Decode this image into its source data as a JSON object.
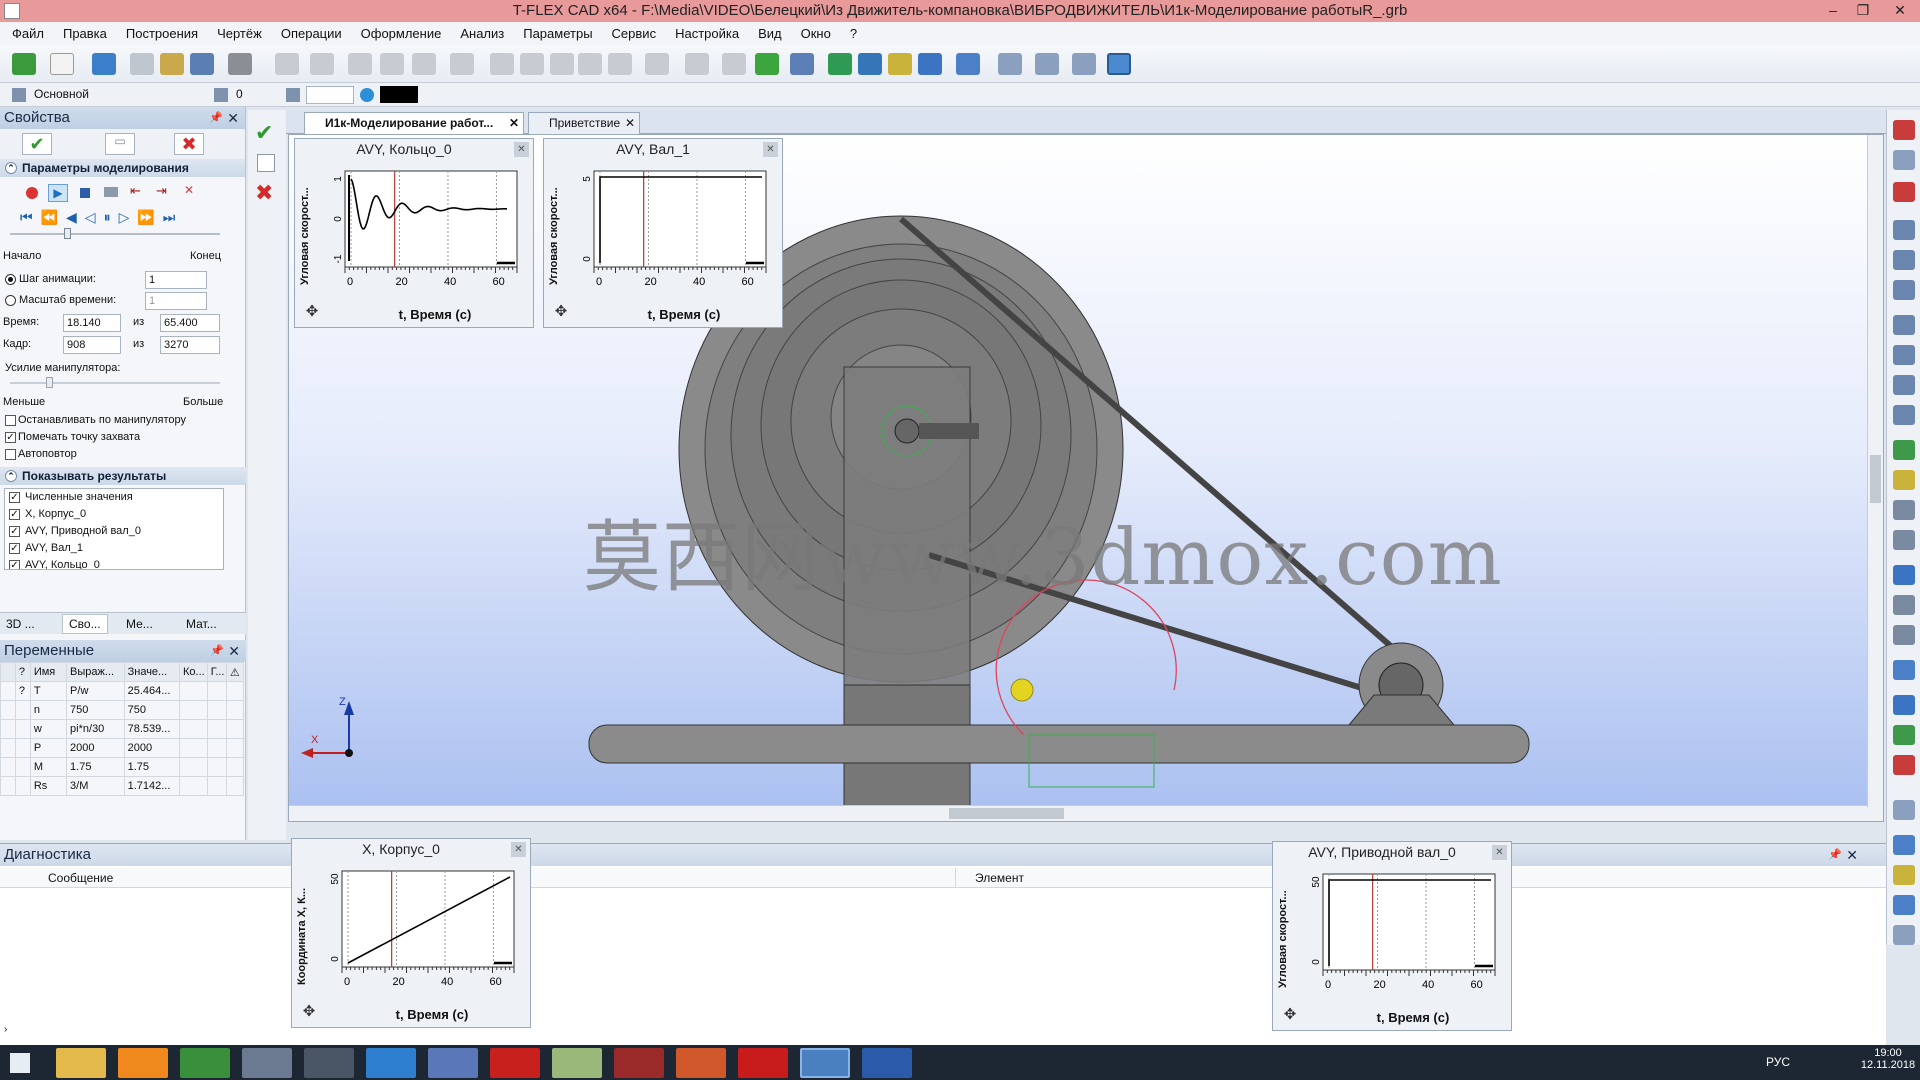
{
  "window": {
    "title": "T-FLEX CAD x64 - F:\\Media\\VIDEO\\Белецкий\\Из Движитель-компановка\\ВИБРОДВИЖИТЕЛЬ\\И1к-Моделирование работыR_.grb",
    "min": "–",
    "max": "❐",
    "close": "✕"
  },
  "menu": [
    "Файл",
    "Правка",
    "Построения",
    "Чертёж",
    "Операции",
    "Оформление",
    "Анализ",
    "Параметры",
    "Сервис",
    "Настройка",
    "Вид",
    "Окно",
    "?"
  ],
  "layerbar": {
    "layer": "Основной",
    "level": "0"
  },
  "properties": {
    "title": "Свойства",
    "sim_section": "Параметры моделирования",
    "start_label": "Начало",
    "end_label": "Конец",
    "anim_step_label": "Шаг анимации:",
    "anim_step_value": "1",
    "time_scale_label": "Масштаб времени:",
    "time_scale_value": "1",
    "time_label": "Время:",
    "time_value": "18.140",
    "time_of": "из",
    "time_total": "65.400",
    "frame_label": "Кадр:",
    "frame_value": "908",
    "frame_of": "из",
    "frame_total": "3270",
    "force_label": "Усилие манипулятора:",
    "less_label": "Меньше",
    "more_label": "Больше",
    "opt_stop": "Останавливать по манипулятору",
    "opt_mark": "Помечать точку захвата",
    "opt_repeat": "Автоповтор",
    "results_section": "Показывать результаты",
    "results": [
      "Численные значения",
      "X, Корпус_0",
      "AVY, Приводной вал_0",
      "AVY, Вал_1",
      "AVY, Кольцо_0"
    ],
    "bottom_tabs": [
      "3D ...",
      "Сво...",
      "Ме...",
      "Мат..."
    ]
  },
  "variables": {
    "title": "Переменные",
    "headers": [
      "?",
      "Имя",
      "Выраж...",
      "Значе...",
      "Ко...",
      "Г..."
    ],
    "rows": [
      {
        "q": "?",
        "name": "T",
        "expr": "P/w",
        "value": "25.464..."
      },
      {
        "q": "",
        "name": "n",
        "expr": "750",
        "value": "750"
      },
      {
        "q": "",
        "name": "w",
        "expr": "pi*n/30",
        "value": "78.539..."
      },
      {
        "q": "",
        "name": "P",
        "expr": "2000",
        "value": "2000"
      },
      {
        "q": "",
        "name": "M",
        "expr": "1.75",
        "value": "1.75"
      },
      {
        "q": "",
        "name": "Rs",
        "expr": "3/M",
        "value": "1.7142..."
      }
    ]
  },
  "tabs": [
    "И1к-Моделирование работ...",
    "Приветствие"
  ],
  "watermark": "莫西网www.3dmox.com",
  "diagnostics": {
    "title": "Диагностика",
    "col_message": "Сообщение",
    "col_element": "Элемент"
  },
  "tray": {
    "lang": "РУС",
    "time": "19:00",
    "date": "12.11.2018"
  },
  "graphs": [
    {
      "title": "AVY, Кольцо_0",
      "ylabel": "Угловая скорост...",
      "xlabel": "t, Время (с)",
      "xticks": [
        "0",
        "20",
        "40",
        "60"
      ],
      "yticks": [
        "-1",
        "0",
        "1"
      ],
      "type": "damped"
    },
    {
      "title": "AVY, Вал_1",
      "ylabel": "Угловая скорост...",
      "xlabel": "t, Время (с)",
      "xticks": [
        "0",
        "20",
        "40",
        "60"
      ],
      "yticks": [
        "0",
        "5"
      ],
      "type": "step"
    },
    {
      "title": "X, Корпус_0",
      "ylabel": "Координата X, К...",
      "xlabel": "t, Время (с)",
      "xticks": [
        "0",
        "20",
        "40",
        "60"
      ],
      "yticks": [
        "0",
        "50"
      ],
      "type": "linear"
    },
    {
      "title": "AVY, Приводной вал_0",
      "ylabel": "Угловая скорост...",
      "xlabel": "t, Время (с)",
      "xticks": [
        "0",
        "20",
        "40",
        "60"
      ],
      "yticks": [
        "0",
        "50"
      ],
      "type": "step"
    }
  ],
  "colors": {
    "titlebar": "#e89a9a",
    "accent": "#1f3f74",
    "cursor_line": "#b0483e"
  }
}
